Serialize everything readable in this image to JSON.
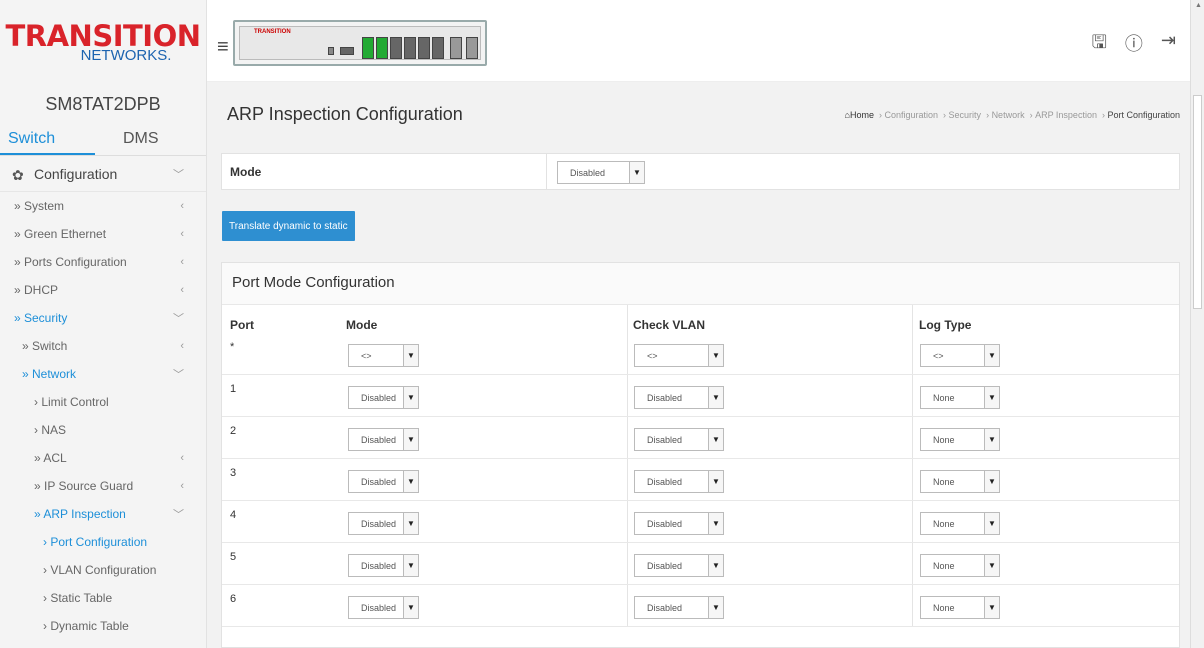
{
  "sidebar": {
    "logo_main": "TRANSITION",
    "logo_sub": "NETWORKS.",
    "device_name": "SM8TAT2DPB",
    "tabs": [
      "Switch",
      "DMS"
    ],
    "config_label": "Configuration",
    "items": [
      {
        "label": "» System",
        "level": 1
      },
      {
        "label": "» Green Ethernet",
        "level": 1
      },
      {
        "label": "» Ports Configuration",
        "level": 1
      },
      {
        "label": "» DHCP",
        "level": 1
      },
      {
        "label": "» Security",
        "level": 1
      },
      {
        "label": "» Switch",
        "level": 2
      },
      {
        "label": "» Network",
        "level": 2
      },
      {
        "label": "› Limit Control",
        "level": 3
      },
      {
        "label": "› NAS",
        "level": 3
      },
      {
        "label": "» ACL",
        "level": 3
      },
      {
        "label": "» IP Source Guard",
        "level": 3
      },
      {
        "label": "» ARP Inspection",
        "level": 3
      },
      {
        "label": "› Port Configuration",
        "level": 4
      },
      {
        "label": "› VLAN Configuration",
        "level": 4
      },
      {
        "label": "› Static Table",
        "level": 4
      },
      {
        "label": "› Dynamic Table",
        "level": 4
      }
    ]
  },
  "header": {
    "device_label": "TRANSITION"
  },
  "page": {
    "title": "ARP Inspection Configuration",
    "breadcrumb": {
      "home": "Home",
      "path": [
        "Configuration",
        "Security",
        "Network",
        "ARP Inspection"
      ],
      "current": "Port Configuration"
    },
    "mode_label": "Mode",
    "mode_value": "Disabled",
    "translate_button": "Translate dynamic to static",
    "port_mode_title": "Port Mode Configuration",
    "columns": {
      "port": "Port",
      "mode": "Mode",
      "check_vlan": "Check VLAN",
      "log_type": "Log Type"
    }
  },
  "rows": [
    {
      "port": "*",
      "mode": "<>",
      "check_vlan": "<>",
      "log_type": "<>"
    },
    {
      "port": "1",
      "mode": "Disabled",
      "check_vlan": "Disabled",
      "log_type": "None"
    },
    {
      "port": "2",
      "mode": "Disabled",
      "check_vlan": "Disabled",
      "log_type": "None"
    },
    {
      "port": "3",
      "mode": "Disabled",
      "check_vlan": "Disabled",
      "log_type": "None"
    },
    {
      "port": "4",
      "mode": "Disabled",
      "check_vlan": "Disabled",
      "log_type": "None"
    },
    {
      "port": "5",
      "mode": "Disabled",
      "check_vlan": "Disabled",
      "log_type": "None"
    },
    {
      "port": "6",
      "mode": "Disabled",
      "check_vlan": "Disabled",
      "log_type": "None"
    }
  ],
  "colors": {
    "accent": "#1d8fd8",
    "button": "#2e8fd1",
    "logo_red": "#d9232a"
  },
  "icons": [
    "hamburger-icon",
    "save-icon",
    "help-icon",
    "logout-icon",
    "gear-icon",
    "home-icon"
  ]
}
